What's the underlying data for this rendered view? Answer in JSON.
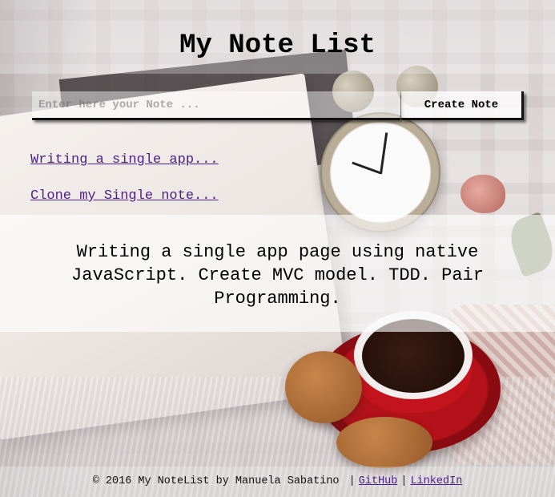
{
  "app": {
    "title": "My Note List"
  },
  "form": {
    "input_placeholder": "Enter here your Note ...",
    "create_button_label": "Create Note"
  },
  "notes": {
    "items": [
      {
        "label": "Writing a single app..."
      },
      {
        "label": "Clone my Single note..."
      }
    ]
  },
  "note_detail": {
    "text": "Writing a single app page using native JavaScript. Create MVC model. TDD. Pair Programming."
  },
  "footer": {
    "copyright": "© 2016 My NoteList by Manuela Sabatino",
    "separator": "|",
    "links": [
      {
        "label": "GitHub"
      },
      {
        "label": "LinkedIn"
      }
    ]
  },
  "colors": {
    "link": "#4b1f86",
    "text": "#000000"
  }
}
